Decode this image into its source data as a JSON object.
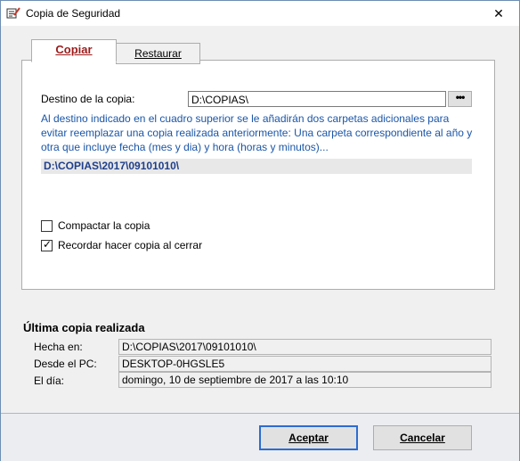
{
  "window": {
    "title": "Copia de Seguridad",
    "close_glyph": "✕"
  },
  "tabs": {
    "copiar": "Copiar",
    "restaurar": "Restaurar"
  },
  "copy": {
    "dest_label": "Destino de la copia:",
    "dest_value": "D:\\COPIAS\\",
    "browse_label": "•••",
    "info_text": "Al destino indicado en el cuadro superior se le añadirán dos carpetas adicionales para evitar reemplazar una copia realizada anteriormente: Una carpeta correspondiente al año y otra que incluye fecha (mes y dia) y hora (horas y minutos)...",
    "resulting_path": "D:\\COPIAS\\2017\\09101010\\",
    "compact_label": "Compactar la copia",
    "compact_checked": false,
    "remember_label": "Recordar hacer copia al cerrar",
    "remember_checked": true
  },
  "last_copy": {
    "title": "Última copia realizada",
    "made_in_label": "Hecha en:",
    "made_in_value": "D:\\COPIAS\\2017\\09101010\\",
    "from_pc_label": "Desde el PC:",
    "from_pc_value": "DESKTOP-0HGSLE5",
    "day_label": "El día:",
    "day_value": "domingo, 10 de septiembre de 2017 a las 10:10"
  },
  "footer": {
    "accept_label": "Aceptar",
    "cancel_label": "Cancelar"
  }
}
